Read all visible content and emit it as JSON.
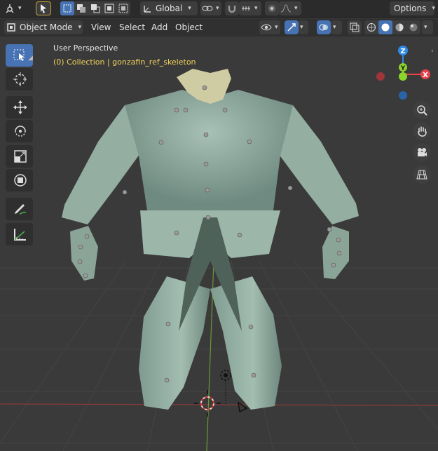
{
  "header1": {
    "transform_orientation": "Global",
    "options_label": "Options"
  },
  "header2": {
    "mode": "Object Mode",
    "menus": [
      "View",
      "Select",
      "Add",
      "Object"
    ]
  },
  "viewport": {
    "view_name": "User Perspective",
    "collection_info": "(0) Collection | gonzafin_ref_skeleton"
  },
  "gizmo": {
    "axes": [
      "Z",
      "Y",
      "X"
    ],
    "colors": {
      "x": "#e8434c",
      "y": "#8ad42c",
      "z": "#2f8ae6"
    }
  },
  "toolbar": {
    "tools": [
      "select-box",
      "cursor",
      "move",
      "rotate",
      "scale",
      "transform",
      "annotate",
      "measure"
    ]
  },
  "navigation": {
    "buttons": [
      "zoom",
      "pan",
      "camera",
      "perspective"
    ]
  },
  "colors": {
    "accent": "#4772b3",
    "header_bg": "#2b2b2b",
    "viewport_bg": "#3a3a3a",
    "mesh": "#8fa99e"
  }
}
